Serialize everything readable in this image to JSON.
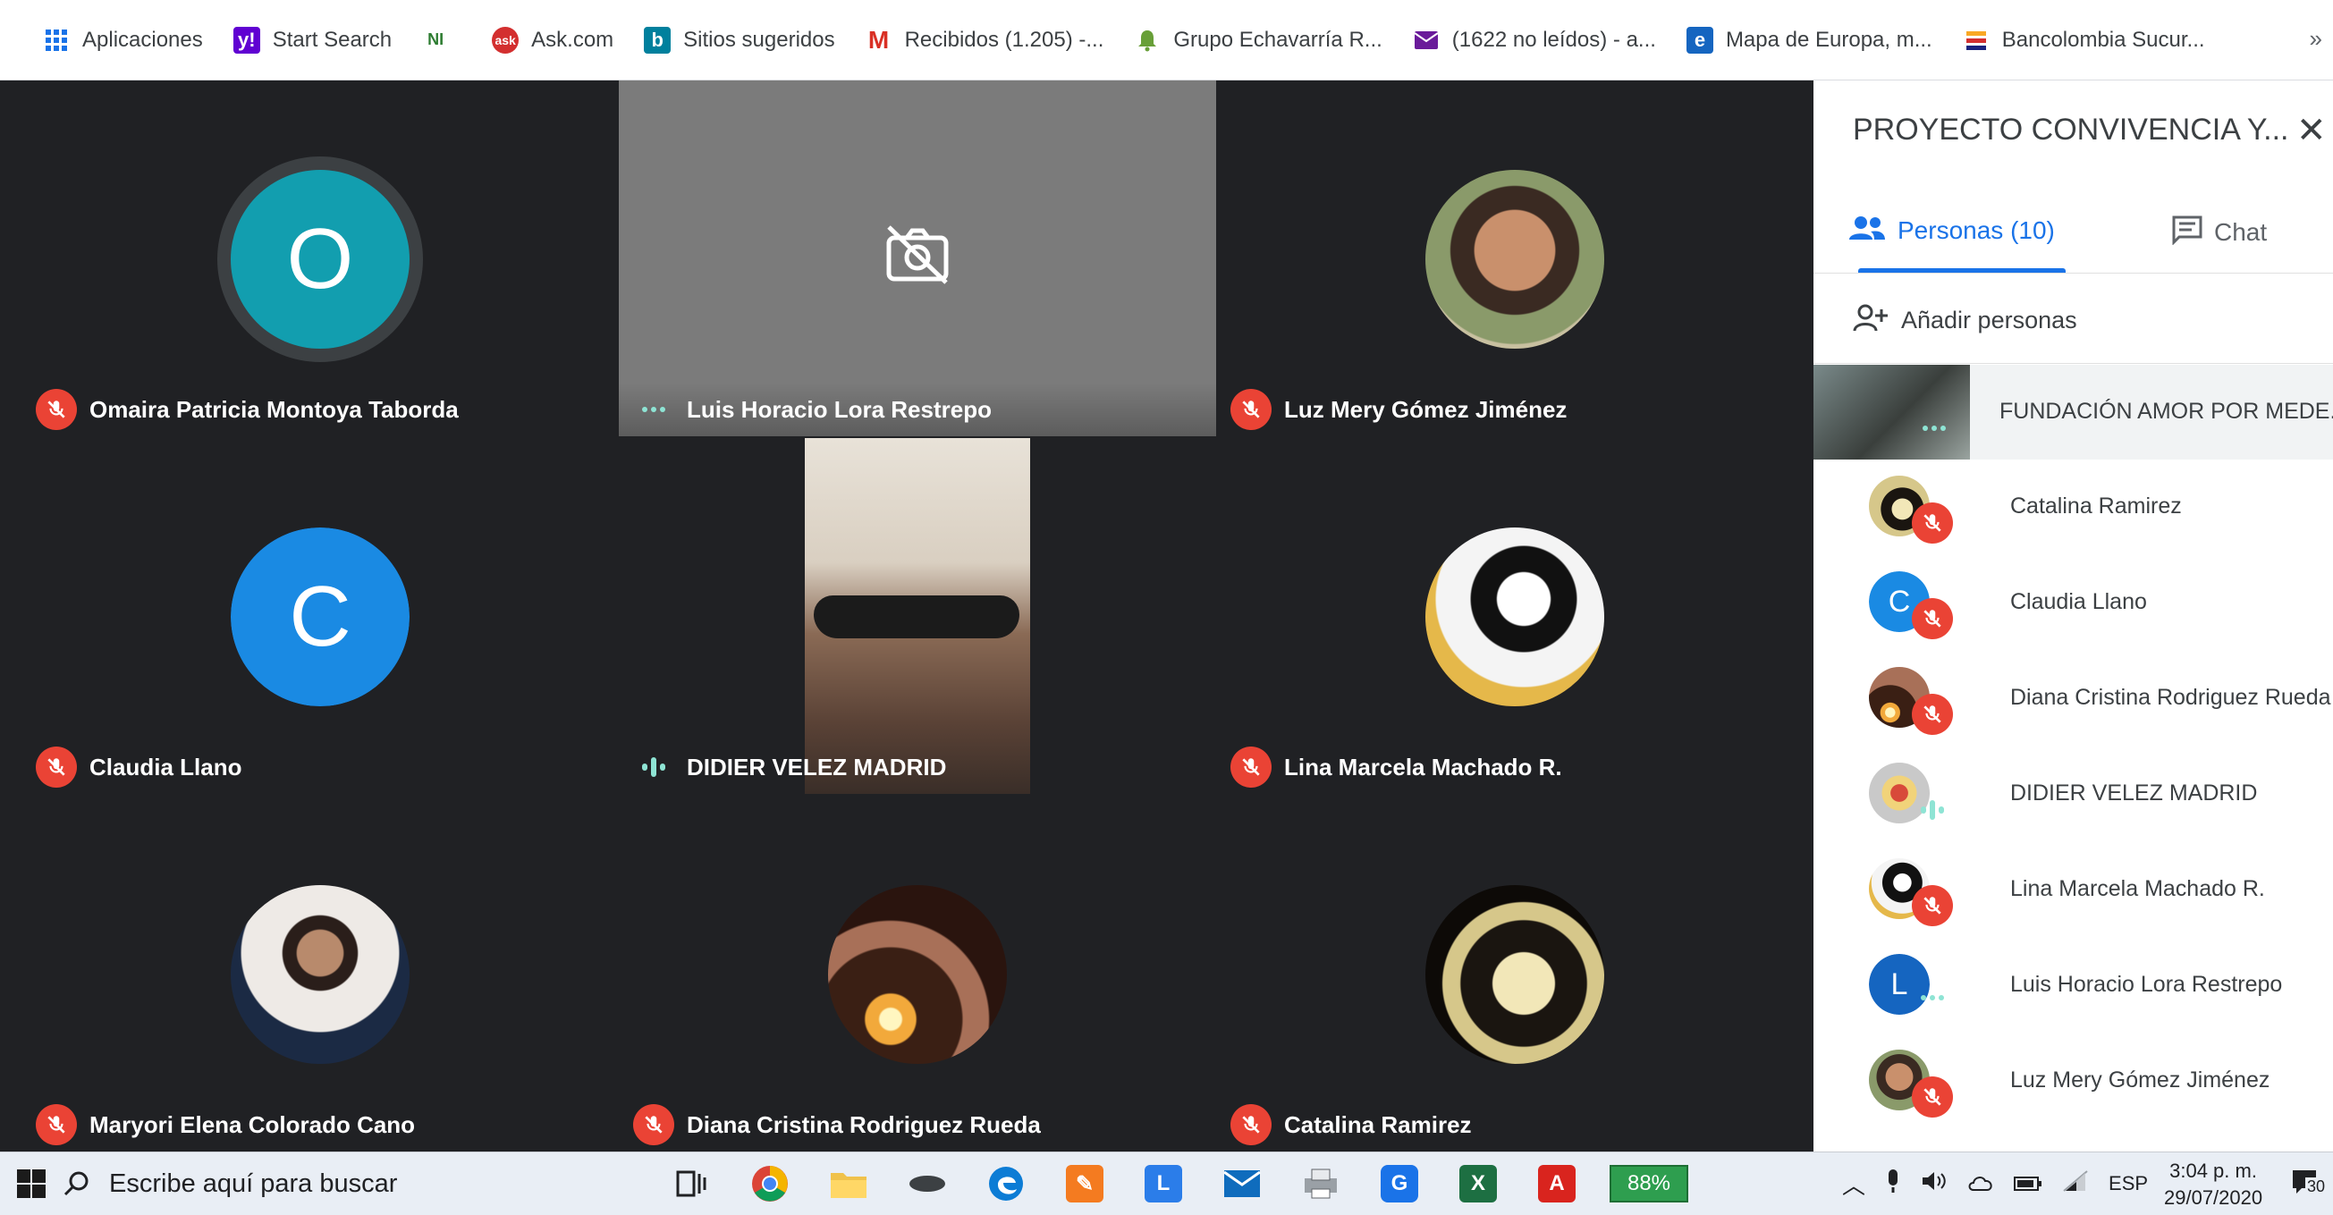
{
  "bookmarks": [
    {
      "label": "Aplicaciones",
      "icon": "apps-grid-icon",
      "color": "#1a73e8"
    },
    {
      "label": "Start Search",
      "icon": "yahoo-icon",
      "color": "#6001d2"
    },
    {
      "label": "",
      "icon": "green-logo-icon",
      "color": "#2e7d32"
    },
    {
      "label": "Ask.com",
      "icon": "ask-icon",
      "color": "#d32f2f"
    },
    {
      "label": "Sitios sugeridos",
      "icon": "bing-icon",
      "color": "#00809d"
    },
    {
      "label": "Recibidos (1.205) -...",
      "icon": "gmail-icon",
      "color": "#d93025"
    },
    {
      "label": "Grupo Echavarría R...",
      "icon": "bell-icon",
      "color": "#689f38"
    },
    {
      "label": "(1622 no leídos) - a...",
      "icon": "mail-icon",
      "color": "#6a1b9a"
    },
    {
      "label": "Mapa de Europa, m...",
      "icon": "e-icon",
      "color": "#1565c0"
    },
    {
      "label": "Bancolombia Sucur...",
      "icon": "bancolombia-icon",
      "color": "#f9a825"
    }
  ],
  "bookmarks_more": "»",
  "tiles": [
    {
      "name": "Omaira Patricia Montoya Taborda",
      "avatar_letter": "O",
      "avatar_color": "#129eaf",
      "status": "muted"
    },
    {
      "name": "Luis Horacio Lora Restrepo",
      "status": "dots",
      "camera_off": true
    },
    {
      "name": "Luz Mery Gómez Jiménez",
      "status": "muted",
      "photo": "woman-portrait"
    },
    {
      "name": "Claudia Llano",
      "avatar_letter": "C",
      "avatar_color": "#1a8ae3",
      "status": "muted"
    },
    {
      "name": "DIDIER VELEZ MADRID",
      "status": "speaking",
      "video": true
    },
    {
      "name": "Lina Marcela Machado R.",
      "status": "muted",
      "photo": "cartoon-girl"
    },
    {
      "name": "Maryori Elena Colorado Cano",
      "status": "muted",
      "photo": "woman-uniform"
    },
    {
      "name": "Diana Cristina Rodriguez Rueda",
      "status": "muted",
      "photo": "candle-portrait"
    },
    {
      "name": "Catalina Ramirez",
      "status": "muted",
      "photo": "sepia-portrait"
    }
  ],
  "panel": {
    "title": "PROYECTO CONVIVENCIA Y...",
    "close": "✕",
    "tab_people": "Personas (10)",
    "tab_chat": "Chat",
    "add_people": "Añadir personas",
    "featured": "FUNDACIÓN AMOR POR MEDE...",
    "participants": [
      {
        "name": "Catalina Ramirez",
        "status": "muted",
        "photo": "sepia-portrait"
      },
      {
        "name": "Claudia Llano",
        "status": "muted",
        "avatar_letter": "C",
        "avatar_color": "#1a8ae3"
      },
      {
        "name": "Diana Cristina Rodriguez Rueda",
        "status": "muted",
        "photo": "candle-portrait"
      },
      {
        "name": "DIDIER VELEZ MADRID",
        "status": "speaking",
        "photo": "logo-badge"
      },
      {
        "name": "Lina Marcela Machado R.",
        "status": "muted",
        "photo": "cartoon-girl"
      },
      {
        "name": "Luis Horacio Lora Restrepo",
        "status": "dots",
        "avatar_letter": "L",
        "avatar_color": "#1565c0"
      },
      {
        "name": "Luz Mery Gómez Jiménez",
        "status": "muted",
        "photo": "woman-portrait"
      }
    ]
  },
  "taskbar": {
    "search_placeholder": "Escribe aquí para buscar",
    "battery": "88%",
    "language": "ESP",
    "time": "3:04 p. m.",
    "date": "29/07/2020",
    "notifications": "30"
  },
  "colors": {
    "meet_bg": "#202124",
    "mute_red": "#ea4335",
    "accent_blue": "#1a73e8",
    "speaking_teal": "#8ee4d4"
  }
}
